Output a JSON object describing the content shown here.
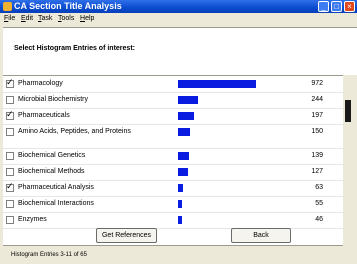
{
  "window": {
    "title": "CA Section Title Analysis",
    "minimize_glyph": "_",
    "maximize_glyph": "□",
    "close_glyph": "×"
  },
  "menu": [
    "File",
    "Edit",
    "Task",
    "Tools",
    "Help"
  ],
  "header": {
    "label": "Select Histogram Entries of interest:"
  },
  "rows": [
    {
      "label": "Pharmacology",
      "value": "972",
      "checked": true
    },
    {
      "label": "Microbial Biochemistry",
      "value": "244",
      "checked": false
    },
    {
      "label": "Pharmaceuticals",
      "value": "197",
      "checked": true
    },
    {
      "label": "Amino Acids, Peptides, and Proteins",
      "value": "150",
      "checked": false
    },
    {
      "label": "Biochemical Genetics",
      "value": "139",
      "checked": false
    },
    {
      "label": "Biochemical Methods",
      "value": "127",
      "checked": false
    },
    {
      "label": "Pharmaceutical Analysis",
      "value": "63",
      "checked": true
    },
    {
      "label": "Biochemical Interactions",
      "value": "55",
      "checked": false
    },
    {
      "label": "Enzymes",
      "value": "46",
      "checked": false
    }
  ],
  "bar_color": "#0a1ce0",
  "buttons": {
    "get_references": "Get References",
    "back": "Back"
  },
  "status": {
    "text": "Histogram Entries 3-11 of 65"
  }
}
